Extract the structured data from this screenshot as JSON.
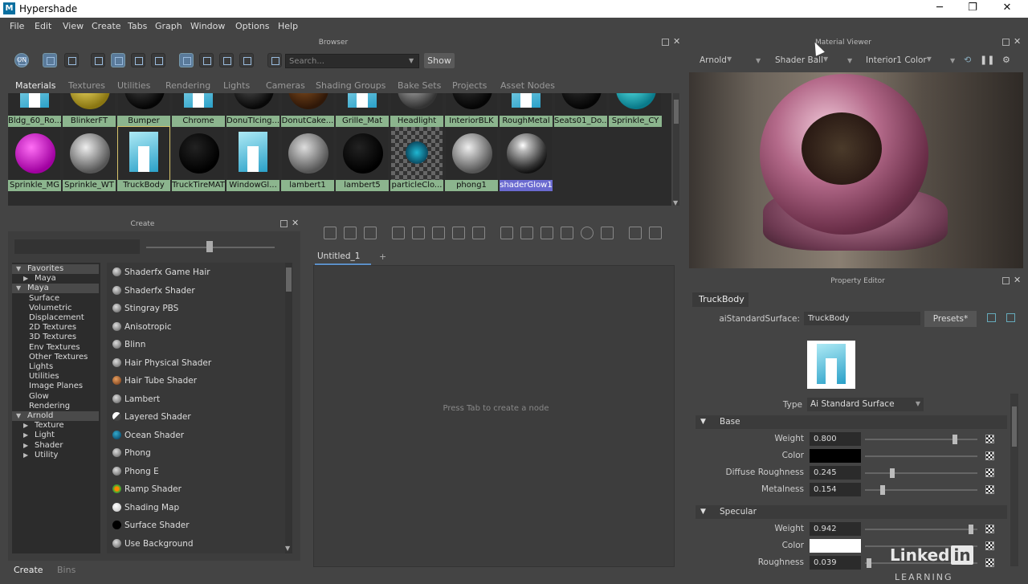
{
  "window": {
    "title": "Hypershade",
    "icon_letter": "M"
  },
  "menu": [
    "File",
    "Edit",
    "View",
    "Create",
    "Tabs",
    "Graph",
    "Window",
    "Options",
    "Help"
  ],
  "browser": {
    "header": "Browser",
    "search_placeholder": "Search...",
    "show_label": "Show",
    "toggle_label": "ON",
    "tabs": [
      "Materials",
      "Textures",
      "Utilities",
      "Rendering",
      "Lights",
      "Cameras",
      "Shading Groups",
      "Bake Sets",
      "Projects",
      "Asset Nodes"
    ],
    "row1": [
      "Bldg_60_Ro...",
      "BlinkerFT",
      "Bumper",
      "Chrome",
      "DonuTIcing...",
      "DonutCake...",
      "Grille_Mat",
      "Headlight",
      "InteriorBLK",
      "RoughMetal",
      "Seats01_Do...",
      "Sprinkle_CY"
    ],
    "row2": [
      "Sprinkle_MG",
      "Sprinkle_WT",
      "TruckBody",
      "TruckTireMAT",
      "WindowGl...",
      "lambert1",
      "lambert5",
      "particleClo...",
      "phong1",
      "shaderGlow1"
    ]
  },
  "create": {
    "header": "Create",
    "tree": [
      {
        "label": "Favorites",
        "level": 0,
        "open": true
      },
      {
        "label": "Maya",
        "level": 1,
        "open": false
      },
      {
        "label": "Maya",
        "level": 0,
        "open": true
      },
      {
        "label": "Surface",
        "level": 2
      },
      {
        "label": "Volumetric",
        "level": 2
      },
      {
        "label": "Displacement",
        "level": 2
      },
      {
        "label": "2D Textures",
        "level": 2
      },
      {
        "label": "3D Textures",
        "level": 2
      },
      {
        "label": "Env Textures",
        "level": 2
      },
      {
        "label": "Other Textures",
        "level": 2
      },
      {
        "label": "Lights",
        "level": 2
      },
      {
        "label": "Utilities",
        "level": 2
      },
      {
        "label": "Image Planes",
        "level": 2
      },
      {
        "label": "Glow",
        "level": 2
      },
      {
        "label": "Rendering",
        "level": 2
      },
      {
        "label": "Arnold",
        "level": 0,
        "open": true
      },
      {
        "label": "Texture",
        "level": 1,
        "open": false
      },
      {
        "label": "Light",
        "level": 1,
        "open": false
      },
      {
        "label": "Shader",
        "level": 1,
        "open": false
      },
      {
        "label": "Utility",
        "level": 1,
        "open": false
      }
    ],
    "items": [
      "Shaderfx Game Hair",
      "Shaderfx Shader",
      "Stingray PBS",
      "Anisotropic",
      "Blinn",
      "Hair Physical Shader",
      "Hair Tube Shader",
      "Lambert",
      "Layered Shader",
      "Ocean Shader",
      "Phong",
      "Phong E",
      "Ramp Shader",
      "Shading Map",
      "Surface Shader",
      "Use Background"
    ],
    "bottom_tabs": [
      "Create",
      "Bins"
    ]
  },
  "graph": {
    "tab": "Untitled_1",
    "plus": "+",
    "hint": "Press Tab to create a node"
  },
  "material_viewer": {
    "header": "Material Viewer",
    "renderer": "Arnold",
    "shape": "Shader Ball",
    "env": "Interior1 Color"
  },
  "property_editor": {
    "header": "Property Editor",
    "tab": "TruckBody",
    "node_type_label": "aiStandardSurface:",
    "node_name": "TruckBody",
    "presets_label": "Presets*",
    "type_label": "Type",
    "type_value": "Ai Standard Surface",
    "sections": [
      {
        "title": "Base",
        "attrs": [
          {
            "label": "Weight",
            "value": "0.800",
            "level": 0.8,
            "kind": "num"
          },
          {
            "label": "Color",
            "value": "",
            "color": "#000000",
            "kind": "color"
          },
          {
            "label": "Diffuse Roughness",
            "value": "0.245",
            "level": 0.245,
            "kind": "num"
          },
          {
            "label": "Metalness",
            "value": "0.154",
            "level": 0.154,
            "kind": "num"
          }
        ]
      },
      {
        "title": "Specular",
        "attrs": [
          {
            "label": "Weight",
            "value": "0.942",
            "level": 0.942,
            "kind": "num"
          },
          {
            "label": "Color",
            "value": "",
            "color": "#ffffff",
            "kind": "color"
          },
          {
            "label": "Roughness",
            "value": "0.039",
            "level": 0.039,
            "kind": "num"
          }
        ]
      }
    ]
  },
  "watermark": {
    "text": "Linked",
    "in": "in",
    "learning": "LEARNING"
  }
}
